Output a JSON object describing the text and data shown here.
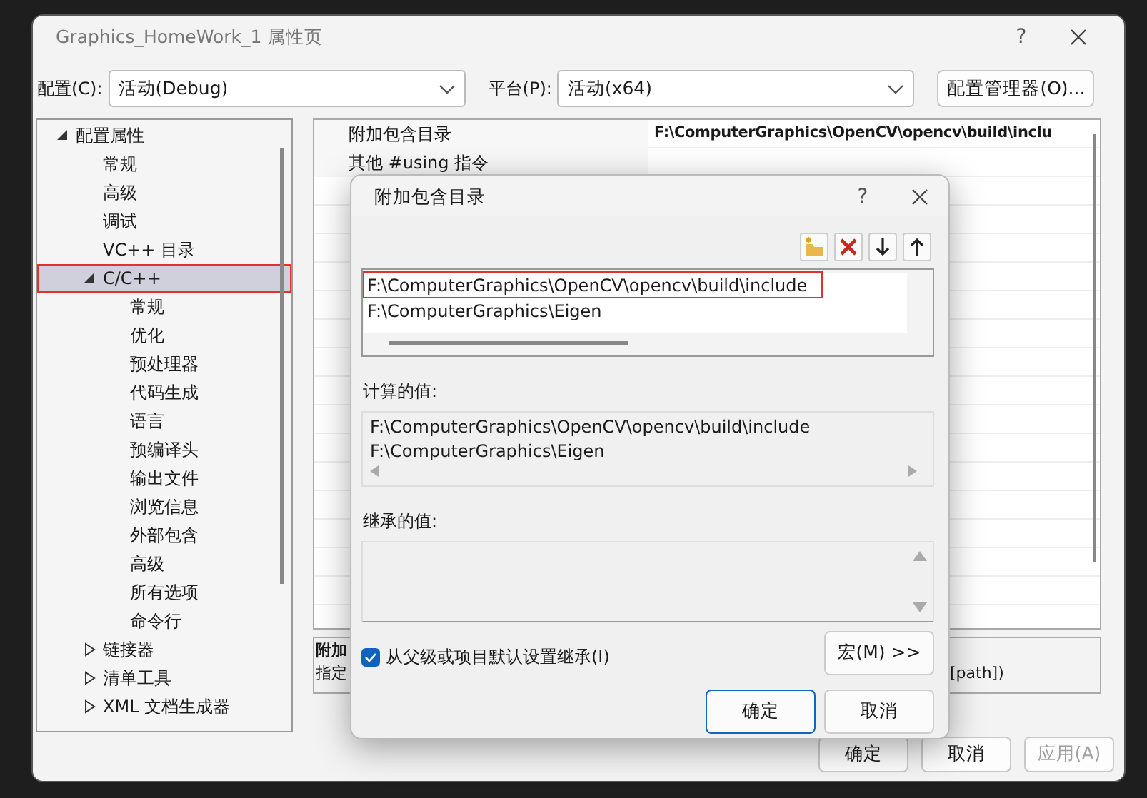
{
  "window": {
    "title": "Graphics_HomeWork_1 属性页",
    "help": "?"
  },
  "config": {
    "label": "配置(C):",
    "value": "活动(Debug)"
  },
  "platform": {
    "label": "平台(P):",
    "value": "活动(x64)"
  },
  "config_manager_button": "配置管理器(O)...",
  "tree": [
    {
      "label": "配置属性",
      "expanded": true,
      "selected": false,
      "outlined": false,
      "children": [
        {
          "label": "常规",
          "selected": false,
          "outlined": false
        },
        {
          "label": "高级",
          "selected": false,
          "outlined": false
        },
        {
          "label": "调试",
          "selected": false,
          "outlined": false
        },
        {
          "label": "VC++ 目录",
          "selected": false,
          "outlined": false
        },
        {
          "label": "C/C++",
          "expanded": true,
          "selected": true,
          "outlined": true,
          "children": [
            {
              "label": "常规",
              "selected": false,
              "outlined": false
            },
            {
              "label": "优化",
              "selected": false,
              "outlined": false
            },
            {
              "label": "预处理器",
              "selected": false,
              "outlined": false
            },
            {
              "label": "代码生成",
              "selected": false,
              "outlined": false
            },
            {
              "label": "语言",
              "selected": false,
              "outlined": false
            },
            {
              "label": "预编译头",
              "selected": false,
              "outlined": false
            },
            {
              "label": "输出文件",
              "selected": false,
              "outlined": false
            },
            {
              "label": "浏览信息",
              "selected": false,
              "outlined": false
            },
            {
              "label": "外部包含",
              "selected": false,
              "outlined": false
            },
            {
              "label": "高级",
              "selected": false,
              "outlined": false
            },
            {
              "label": "所有选项",
              "selected": false,
              "outlined": false
            },
            {
              "label": "命令行",
              "selected": false,
              "outlined": false
            }
          ]
        },
        {
          "label": "链接器",
          "expanded": false,
          "selected": false,
          "outlined": false
        },
        {
          "label": "清单工具",
          "expanded": false,
          "selected": false,
          "outlined": false
        },
        {
          "label": "XML 文档生成器",
          "expanded": false,
          "selected": false,
          "outlined": false
        }
      ]
    }
  ],
  "property_grid": {
    "rows": [
      {
        "name": "附加包含目录",
        "value": "F:\\ComputerGraphics\\OpenCV\\opencv\\build\\inclu"
      },
      {
        "name": "其他 #using 指令"
      }
    ]
  },
  "description": {
    "title": "附加",
    "text": "指定",
    "text_end": "[path])"
  },
  "buttons": [
    {
      "label": "确定",
      "disabled": false
    },
    {
      "label": "取消",
      "disabled": false
    },
    {
      "label": "应用(A)",
      "disabled": true
    }
  ],
  "dialog": {
    "title": "附加包含目录",
    "help": "?",
    "toolbar": [
      {
        "kind": "new-folder"
      },
      {
        "kind": "delete"
      },
      {
        "kind": "move-down"
      },
      {
        "kind": "move-up"
      }
    ],
    "entries": [
      {
        "text": "F:\\ComputerGraphics\\OpenCV\\opencv\\build\\include",
        "outlined": true
      },
      {
        "text": "F:\\ComputerGraphics\\Eigen",
        "outlined": false
      }
    ],
    "computed_label": "计算的值:",
    "computed": [
      "F:\\ComputerGraphics\\OpenCV\\opencv\\build\\include",
      "F:\\ComputerGraphics\\Eigen"
    ],
    "inherited_label": "继承的值:",
    "inherit": {
      "label": "从父级或项目默认设置继承(I)",
      "checked": true
    },
    "macro_button": "宏(M) >>",
    "buttons": [
      {
        "label": "确定",
        "default": true
      },
      {
        "label": "取消",
        "default": false
      }
    ]
  }
}
